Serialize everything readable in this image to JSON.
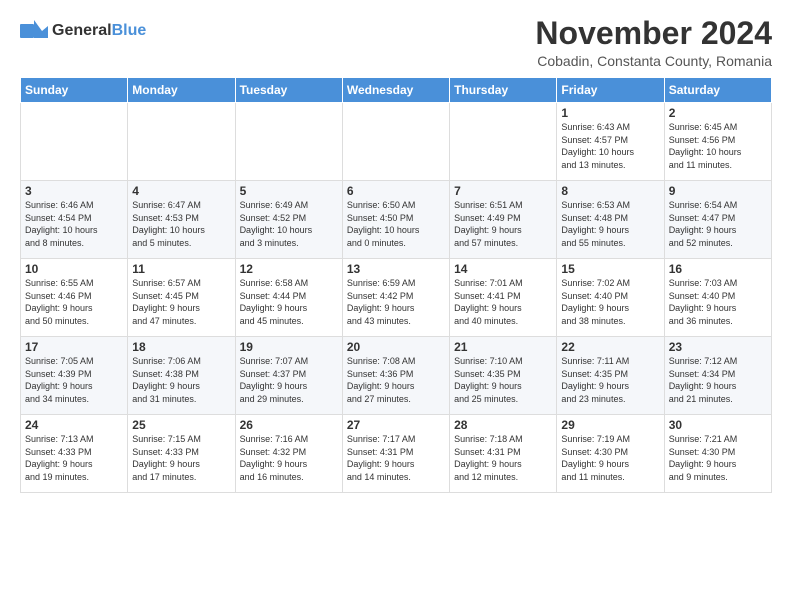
{
  "header": {
    "logo": {
      "general": "General",
      "blue": "Blue"
    },
    "title": "November 2024",
    "location": "Cobadin, Constanta County, Romania"
  },
  "calendar": {
    "days": [
      "Sunday",
      "Monday",
      "Tuesday",
      "Wednesday",
      "Thursday",
      "Friday",
      "Saturday"
    ],
    "weeks": [
      [
        {
          "day": "",
          "info": ""
        },
        {
          "day": "",
          "info": ""
        },
        {
          "day": "",
          "info": ""
        },
        {
          "day": "",
          "info": ""
        },
        {
          "day": "",
          "info": ""
        },
        {
          "day": "1",
          "info": "Sunrise: 6:43 AM\nSunset: 4:57 PM\nDaylight: 10 hours\nand 13 minutes."
        },
        {
          "day": "2",
          "info": "Sunrise: 6:45 AM\nSunset: 4:56 PM\nDaylight: 10 hours\nand 11 minutes."
        }
      ],
      [
        {
          "day": "3",
          "info": "Sunrise: 6:46 AM\nSunset: 4:54 PM\nDaylight: 10 hours\nand 8 minutes."
        },
        {
          "day": "4",
          "info": "Sunrise: 6:47 AM\nSunset: 4:53 PM\nDaylight: 10 hours\nand 5 minutes."
        },
        {
          "day": "5",
          "info": "Sunrise: 6:49 AM\nSunset: 4:52 PM\nDaylight: 10 hours\nand 3 minutes."
        },
        {
          "day": "6",
          "info": "Sunrise: 6:50 AM\nSunset: 4:50 PM\nDaylight: 10 hours\nand 0 minutes."
        },
        {
          "day": "7",
          "info": "Sunrise: 6:51 AM\nSunset: 4:49 PM\nDaylight: 9 hours\nand 57 minutes."
        },
        {
          "day": "8",
          "info": "Sunrise: 6:53 AM\nSunset: 4:48 PM\nDaylight: 9 hours\nand 55 minutes."
        },
        {
          "day": "9",
          "info": "Sunrise: 6:54 AM\nSunset: 4:47 PM\nDaylight: 9 hours\nand 52 minutes."
        }
      ],
      [
        {
          "day": "10",
          "info": "Sunrise: 6:55 AM\nSunset: 4:46 PM\nDaylight: 9 hours\nand 50 minutes."
        },
        {
          "day": "11",
          "info": "Sunrise: 6:57 AM\nSunset: 4:45 PM\nDaylight: 9 hours\nand 47 minutes."
        },
        {
          "day": "12",
          "info": "Sunrise: 6:58 AM\nSunset: 4:44 PM\nDaylight: 9 hours\nand 45 minutes."
        },
        {
          "day": "13",
          "info": "Sunrise: 6:59 AM\nSunset: 4:42 PM\nDaylight: 9 hours\nand 43 minutes."
        },
        {
          "day": "14",
          "info": "Sunrise: 7:01 AM\nSunset: 4:41 PM\nDaylight: 9 hours\nand 40 minutes."
        },
        {
          "day": "15",
          "info": "Sunrise: 7:02 AM\nSunset: 4:40 PM\nDaylight: 9 hours\nand 38 minutes."
        },
        {
          "day": "16",
          "info": "Sunrise: 7:03 AM\nSunset: 4:40 PM\nDaylight: 9 hours\nand 36 minutes."
        }
      ],
      [
        {
          "day": "17",
          "info": "Sunrise: 7:05 AM\nSunset: 4:39 PM\nDaylight: 9 hours\nand 34 minutes."
        },
        {
          "day": "18",
          "info": "Sunrise: 7:06 AM\nSunset: 4:38 PM\nDaylight: 9 hours\nand 31 minutes."
        },
        {
          "day": "19",
          "info": "Sunrise: 7:07 AM\nSunset: 4:37 PM\nDaylight: 9 hours\nand 29 minutes."
        },
        {
          "day": "20",
          "info": "Sunrise: 7:08 AM\nSunset: 4:36 PM\nDaylight: 9 hours\nand 27 minutes."
        },
        {
          "day": "21",
          "info": "Sunrise: 7:10 AM\nSunset: 4:35 PM\nDaylight: 9 hours\nand 25 minutes."
        },
        {
          "day": "22",
          "info": "Sunrise: 7:11 AM\nSunset: 4:35 PM\nDaylight: 9 hours\nand 23 minutes."
        },
        {
          "day": "23",
          "info": "Sunrise: 7:12 AM\nSunset: 4:34 PM\nDaylight: 9 hours\nand 21 minutes."
        }
      ],
      [
        {
          "day": "24",
          "info": "Sunrise: 7:13 AM\nSunset: 4:33 PM\nDaylight: 9 hours\nand 19 minutes."
        },
        {
          "day": "25",
          "info": "Sunrise: 7:15 AM\nSunset: 4:33 PM\nDaylight: 9 hours\nand 17 minutes."
        },
        {
          "day": "26",
          "info": "Sunrise: 7:16 AM\nSunset: 4:32 PM\nDaylight: 9 hours\nand 16 minutes."
        },
        {
          "day": "27",
          "info": "Sunrise: 7:17 AM\nSunset: 4:31 PM\nDaylight: 9 hours\nand 14 minutes."
        },
        {
          "day": "28",
          "info": "Sunrise: 7:18 AM\nSunset: 4:31 PM\nDaylight: 9 hours\nand 12 minutes."
        },
        {
          "day": "29",
          "info": "Sunrise: 7:19 AM\nSunset: 4:30 PM\nDaylight: 9 hours\nand 11 minutes."
        },
        {
          "day": "30",
          "info": "Sunrise: 7:21 AM\nSunset: 4:30 PM\nDaylight: 9 hours\nand 9 minutes."
        }
      ]
    ]
  }
}
